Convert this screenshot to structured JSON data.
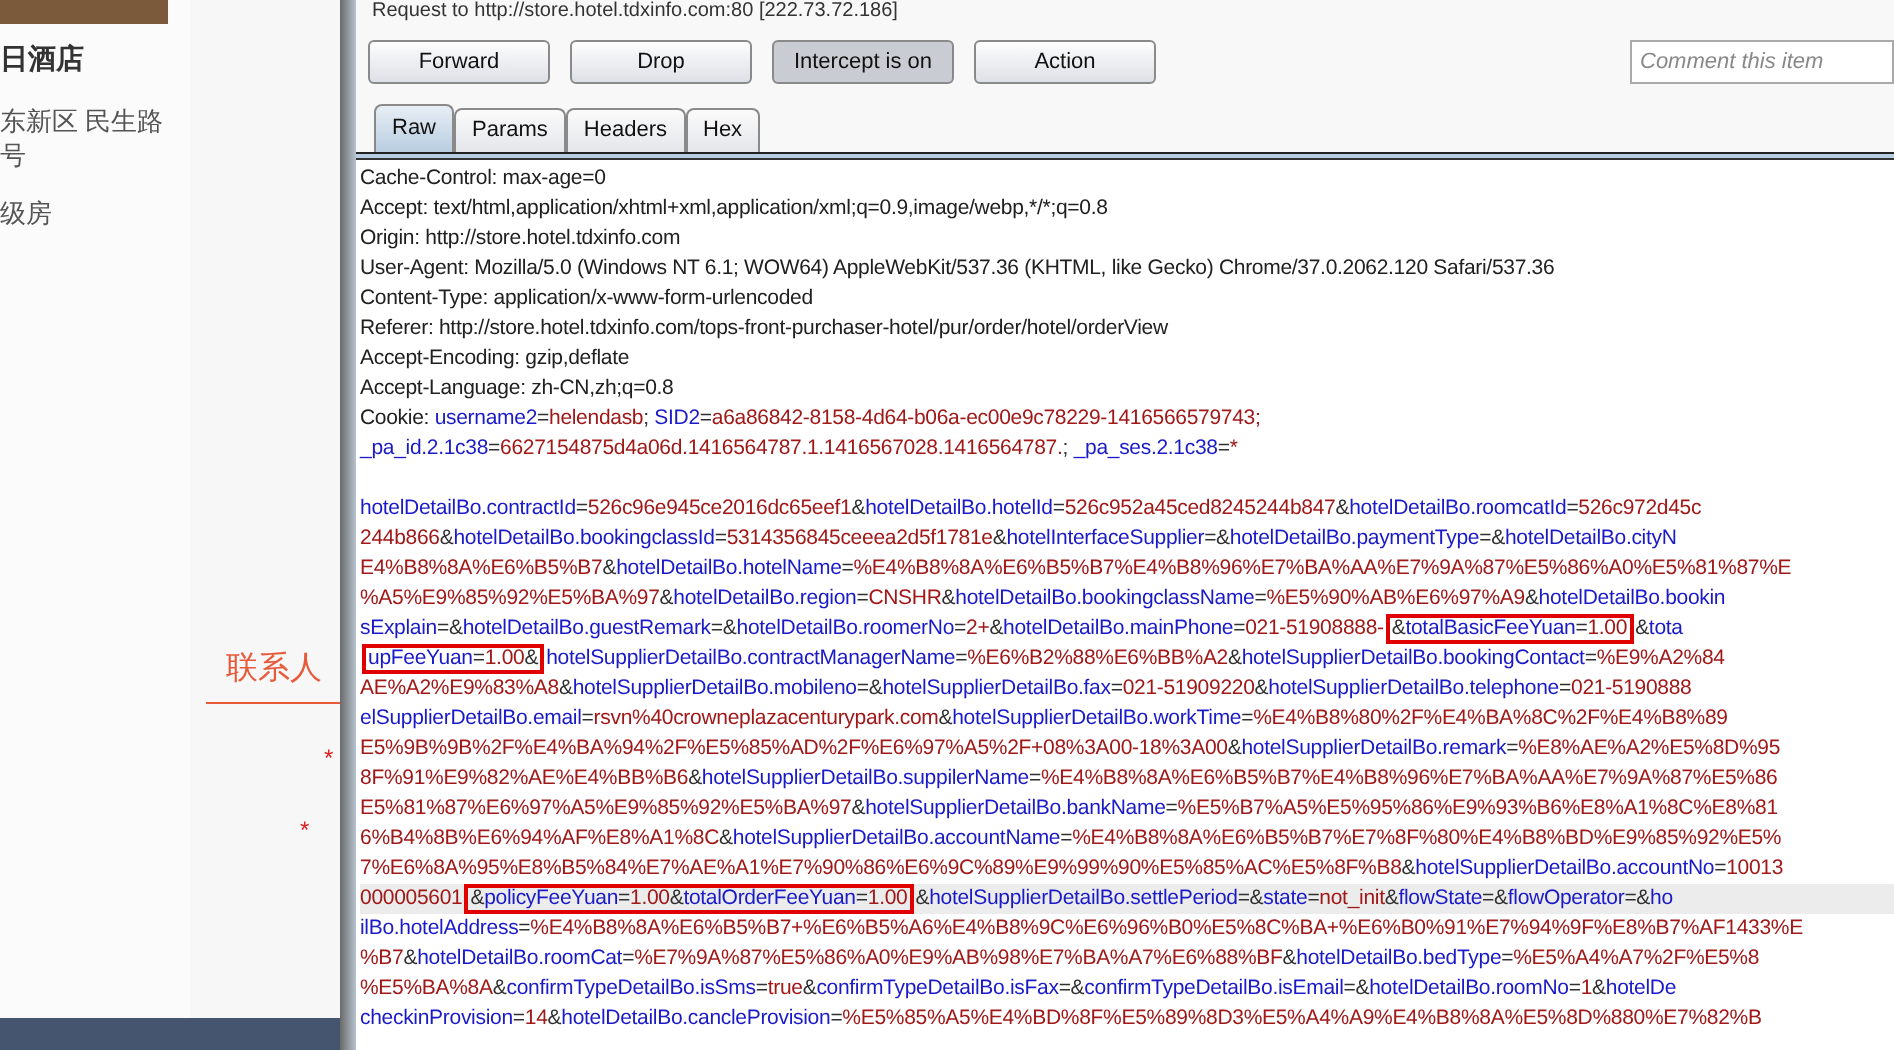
{
  "page": {
    "hotel_name": "日酒店",
    "address_lines": [
      "东新区 民生路",
      "号"
    ],
    "room_type": "级房",
    "section_title": "联系人",
    "required_marks": [
      "*",
      "*"
    ]
  },
  "burp": {
    "request_title": "Request to http://store.hotel.tdxinfo.com:80  [222.73.72.186]",
    "buttons": [
      {
        "label": "Forward",
        "pressed": false
      },
      {
        "label": "Drop",
        "pressed": false
      },
      {
        "label": "Intercept is on",
        "pressed": true
      },
      {
        "label": "Action",
        "pressed": false
      }
    ],
    "comment": {
      "placeholder": "Comment this item"
    },
    "tabs": [
      {
        "label": "Raw",
        "selected": true
      },
      {
        "label": "Params",
        "selected": false
      },
      {
        "label": "Headers",
        "selected": false
      },
      {
        "label": "Hex",
        "selected": false
      }
    ],
    "headers": [
      {
        "segments": [
          {
            "kind": "plain",
            "text": "Cache-Control: max-age=0"
          }
        ]
      },
      {
        "segments": [
          {
            "kind": "plain",
            "text": "Accept: text/html,application/xhtml+xml,application/xml;q=0.9,image/webp,*/*;q=0.8"
          }
        ]
      },
      {
        "segments": [
          {
            "kind": "plain",
            "text": "Origin: http://store.hotel.tdxinfo.com"
          }
        ]
      },
      {
        "segments": [
          {
            "kind": "plain",
            "text": "User-Agent: Mozilla/5.0 (Windows NT 6.1; WOW64) AppleWebKit/537.36 (KHTML, like Gecko) Chrome/37.0.2062.120 Safari/537.36"
          }
        ]
      },
      {
        "segments": [
          {
            "kind": "plain",
            "text": "Content-Type: application/x-www-form-urlencoded"
          }
        ]
      },
      {
        "segments": [
          {
            "kind": "plain",
            "text": "Referer: http://store.hotel.tdxinfo.com/tops-front-purchaser-hotel/pur/order/hotel/orderView"
          }
        ]
      },
      {
        "segments": [
          {
            "kind": "plain",
            "text": "Accept-Encoding: gzip,deflate"
          }
        ]
      },
      {
        "segments": [
          {
            "kind": "plain",
            "text": "Accept-Language: zh-CN,zh;q=0.8"
          }
        ]
      },
      {
        "segments": [
          {
            "kind": "plain",
            "text": "Cookie: "
          },
          {
            "kind": "key",
            "text": "username2"
          },
          {
            "kind": "sep",
            "text": "="
          },
          {
            "kind": "value",
            "text": "helendasb"
          },
          {
            "kind": "sep",
            "text": "; "
          },
          {
            "kind": "key",
            "text": "SID2"
          },
          {
            "kind": "sep",
            "text": "="
          },
          {
            "kind": "value",
            "text": "a6a86842-8158-4d64-b06a-ec00e9c78229-1416566579743;"
          }
        ]
      },
      {
        "segments": [
          {
            "kind": "key",
            "text": "_pa_id.2.1c38"
          },
          {
            "kind": "sep",
            "text": "="
          },
          {
            "kind": "value",
            "text": "6627154875d4a06d.1416564787.1.1416567028.1416564787."
          },
          {
            "kind": "sep",
            "text": "; "
          },
          {
            "kind": "key",
            "text": "_pa_ses.2.1c38"
          },
          {
            "kind": "sep",
            "text": "="
          },
          {
            "kind": "value",
            "text": "*"
          }
        ]
      }
    ],
    "body": [
      {
        "selected": false,
        "runs": [
          {
            "boxed": false,
            "segments": [
              {
                "kind": "key",
                "text": "hotelDetailBo.contractId"
              },
              {
                "kind": "sep",
                "text": "="
              },
              {
                "kind": "value",
                "text": "526c96e945ce2016dc65eef1"
              },
              {
                "kind": "sep",
                "text": "&"
              },
              {
                "kind": "key",
                "text": "hotelDetailBo.hotelId"
              },
              {
                "kind": "sep",
                "text": "="
              },
              {
                "kind": "value",
                "text": "526c952a45ced8245244b847"
              },
              {
                "kind": "sep",
                "text": "&"
              },
              {
                "kind": "key",
                "text": "hotelDetailBo.roomcatId"
              },
              {
                "kind": "sep",
                "text": "="
              },
              {
                "kind": "value",
                "text": "526c972d45c"
              }
            ]
          }
        ]
      },
      {
        "selected": false,
        "runs": [
          {
            "boxed": false,
            "segments": [
              {
                "kind": "value",
                "text": "244b866"
              },
              {
                "kind": "sep",
                "text": "&"
              },
              {
                "kind": "key",
                "text": "hotelDetailBo.bookingclassId"
              },
              {
                "kind": "sep",
                "text": "="
              },
              {
                "kind": "value",
                "text": "5314356845ceeea2d5f1781e"
              },
              {
                "kind": "sep",
                "text": "&"
              },
              {
                "kind": "key",
                "text": "hotelInterfaceSupplier"
              },
              {
                "kind": "sep",
                "text": "=&"
              },
              {
                "kind": "key",
                "text": "hotelDetailBo.paymentType"
              },
              {
                "kind": "sep",
                "text": "=&"
              },
              {
                "kind": "key",
                "text": "hotelDetailBo.cityN"
              }
            ]
          }
        ]
      },
      {
        "selected": false,
        "runs": [
          {
            "boxed": false,
            "segments": [
              {
                "kind": "value",
                "text": "E4%B8%8A%E6%B5%B7"
              },
              {
                "kind": "sep",
                "text": "&"
              },
              {
                "kind": "key",
                "text": "hotelDetailBo.hotelName"
              },
              {
                "kind": "sep",
                "text": "="
              },
              {
                "kind": "value",
                "text": "%E4%B8%8A%E6%B5%B7%E4%B8%96%E7%BA%AA%E7%9A%87%E5%86%A0%E5%81%87%E"
              }
            ]
          }
        ]
      },
      {
        "selected": false,
        "runs": [
          {
            "boxed": false,
            "segments": [
              {
                "kind": "value",
                "text": "%A5%E9%85%92%E5%BA%97"
              },
              {
                "kind": "sep",
                "text": "&"
              },
              {
                "kind": "key",
                "text": "hotelDetailBo.region"
              },
              {
                "kind": "sep",
                "text": "="
              },
              {
                "kind": "value",
                "text": "CNSHR"
              },
              {
                "kind": "sep",
                "text": "&"
              },
              {
                "kind": "key",
                "text": "hotelDetailBo.bookingclassName"
              },
              {
                "kind": "sep",
                "text": "="
              },
              {
                "kind": "value",
                "text": "%E5%90%AB%E6%97%A9"
              },
              {
                "kind": "sep",
                "text": "&"
              },
              {
                "kind": "key",
                "text": "hotelDetailBo.bookin"
              }
            ]
          }
        ]
      },
      {
        "selected": false,
        "runs": [
          {
            "boxed": false,
            "segments": [
              {
                "kind": "key",
                "text": "sExplain"
              },
              {
                "kind": "sep",
                "text": "=&"
              },
              {
                "kind": "key",
                "text": "hotelDetailBo.guestRemark"
              },
              {
                "kind": "sep",
                "text": "=&"
              },
              {
                "kind": "key",
                "text": "hotelDetailBo.roomerNo"
              },
              {
                "kind": "sep",
                "text": "="
              },
              {
                "kind": "value",
                "text": "2+"
              },
              {
                "kind": "sep",
                "text": "&"
              },
              {
                "kind": "key",
                "text": "hotelDetailBo.mainPhone"
              },
              {
                "kind": "sep",
                "text": "="
              },
              {
                "kind": "value",
                "text": "021-51908888-"
              }
            ]
          },
          {
            "boxed": true,
            "segments": [
              {
                "kind": "sep",
                "text": "&"
              },
              {
                "kind": "key",
                "text": "totalBasicFeeYuan"
              },
              {
                "kind": "sep",
                "text": "="
              },
              {
                "kind": "value",
                "text": "1.00"
              }
            ]
          },
          {
            "boxed": false,
            "segments": [
              {
                "kind": "sep",
                "text": "&"
              },
              {
                "kind": "key",
                "text": "tota"
              }
            ]
          }
        ]
      },
      {
        "selected": false,
        "runs": [
          {
            "boxed": true,
            "segments": [
              {
                "kind": "key",
                "text": "upFeeYuan"
              },
              {
                "kind": "sep",
                "text": "="
              },
              {
                "kind": "value",
                "text": "1.00"
              },
              {
                "kind": "sep",
                "text": "&"
              }
            ]
          },
          {
            "boxed": false,
            "segments": [
              {
                "kind": "key",
                "text": "hotelSupplierDetailBo.contractManagerName"
              },
              {
                "kind": "sep",
                "text": "="
              },
              {
                "kind": "value",
                "text": "%E6%B2%88%E6%BB%A2"
              },
              {
                "kind": "sep",
                "text": "&"
              },
              {
                "kind": "key",
                "text": "hotelSupplierDetailBo.bookingContact"
              },
              {
                "kind": "sep",
                "text": "="
              },
              {
                "kind": "value",
                "text": "%E9%A2%84"
              }
            ]
          }
        ]
      },
      {
        "selected": false,
        "runs": [
          {
            "boxed": false,
            "segments": [
              {
                "kind": "value",
                "text": "AE%A2%E9%83%A8"
              },
              {
                "kind": "sep",
                "text": "&"
              },
              {
                "kind": "key",
                "text": "hotelSupplierDetailBo.mobileno"
              },
              {
                "kind": "sep",
                "text": "=&"
              },
              {
                "kind": "key",
                "text": "hotelSupplierDetailBo.fax"
              },
              {
                "kind": "sep",
                "text": "="
              },
              {
                "kind": "value",
                "text": "021-51909220"
              },
              {
                "kind": "sep",
                "text": "&"
              },
              {
                "kind": "key",
                "text": "hotelSupplierDetailBo.telephone"
              },
              {
                "kind": "sep",
                "text": "="
              },
              {
                "kind": "value",
                "text": "021-5190888"
              }
            ]
          }
        ]
      },
      {
        "selected": false,
        "runs": [
          {
            "boxed": false,
            "segments": [
              {
                "kind": "key",
                "text": "elSupplierDetailBo.email"
              },
              {
                "kind": "sep",
                "text": "="
              },
              {
                "kind": "value",
                "text": "rsvn%40crowneplazacenturypark.com"
              },
              {
                "kind": "sep",
                "text": "&"
              },
              {
                "kind": "key",
                "text": "hotelSupplierDetailBo.workTime"
              },
              {
                "kind": "sep",
                "text": "="
              },
              {
                "kind": "value",
                "text": "%E4%B8%80%2F%E4%BA%8C%2F%E4%B8%89"
              }
            ]
          }
        ]
      },
      {
        "selected": false,
        "runs": [
          {
            "boxed": false,
            "segments": [
              {
                "kind": "value",
                "text": "E5%9B%9B%2F%E4%BA%94%2F%E5%85%AD%2F%E6%97%A5%2F+08%3A00-18%3A00"
              },
              {
                "kind": "sep",
                "text": "&"
              },
              {
                "kind": "key",
                "text": "hotelSupplierDetailBo.remark"
              },
              {
                "kind": "sep",
                "text": "="
              },
              {
                "kind": "value",
                "text": "%E8%AE%A2%E5%8D%95"
              }
            ]
          }
        ]
      },
      {
        "selected": false,
        "runs": [
          {
            "boxed": false,
            "segments": [
              {
                "kind": "value",
                "text": "8F%91%E9%82%AE%E4%BB%B6"
              },
              {
                "kind": "sep",
                "text": "&"
              },
              {
                "kind": "key",
                "text": "hotelSupplierDetailBo.suppilerName"
              },
              {
                "kind": "sep",
                "text": "="
              },
              {
                "kind": "value",
                "text": "%E4%B8%8A%E6%B5%B7%E4%B8%96%E7%BA%AA%E7%9A%87%E5%86"
              }
            ]
          }
        ]
      },
      {
        "selected": false,
        "runs": [
          {
            "boxed": false,
            "segments": [
              {
                "kind": "value",
                "text": "E5%81%87%E6%97%A5%E9%85%92%E5%BA%97"
              },
              {
                "kind": "sep",
                "text": "&"
              },
              {
                "kind": "key",
                "text": "hotelSupplierDetailBo.bankName"
              },
              {
                "kind": "sep",
                "text": "="
              },
              {
                "kind": "value",
                "text": "%E5%B7%A5%E5%95%86%E9%93%B6%E8%A1%8C%E8%81"
              }
            ]
          }
        ]
      },
      {
        "selected": false,
        "runs": [
          {
            "boxed": false,
            "segments": [
              {
                "kind": "value",
                "text": "6%B4%8B%E6%94%AF%E8%A1%8C"
              },
              {
                "kind": "sep",
                "text": "&"
              },
              {
                "kind": "key",
                "text": "hotelSupplierDetailBo.accountName"
              },
              {
                "kind": "sep",
                "text": "="
              },
              {
                "kind": "value",
                "text": "%E4%B8%8A%E6%B5%B7%E7%8F%80%E4%B8%BD%E9%85%92%E5%"
              }
            ]
          }
        ]
      },
      {
        "selected": false,
        "runs": [
          {
            "boxed": false,
            "segments": [
              {
                "kind": "value",
                "text": "7%E6%8A%95%E8%B5%84%E7%AE%A1%E7%90%86%E6%9C%89%E9%99%90%E5%85%AC%E5%8F%B8"
              },
              {
                "kind": "sep",
                "text": "&"
              },
              {
                "kind": "key",
                "text": "hotelSupplierDetailBo.accountNo"
              },
              {
                "kind": "sep",
                "text": "="
              },
              {
                "kind": "value",
                "text": "10013"
              }
            ]
          }
        ]
      },
      {
        "selected": true,
        "runs": [
          {
            "boxed": false,
            "segments": [
              {
                "kind": "value",
                "text": "000005601"
              }
            ]
          },
          {
            "boxed": true,
            "segments": [
              {
                "kind": "sep",
                "text": "&"
              },
              {
                "kind": "key",
                "text": "policyFeeYuan"
              },
              {
                "kind": "sep",
                "text": "="
              },
              {
                "kind": "value",
                "text": "1.00"
              },
              {
                "kind": "sep",
                "text": "&"
              },
              {
                "kind": "key",
                "text": "totalOrderFeeYuan"
              },
              {
                "kind": "sep",
                "text": "="
              },
              {
                "kind": "value",
                "text": "1.00"
              }
            ]
          },
          {
            "boxed": false,
            "segments": [
              {
                "kind": "sep",
                "text": "&"
              },
              {
                "kind": "key",
                "text": "hotelSupplierDetailBo.settlePeriod"
              },
              {
                "kind": "sep",
                "text": "=&"
              },
              {
                "kind": "key",
                "text": "state"
              },
              {
                "kind": "sep",
                "text": "="
              },
              {
                "kind": "value",
                "text": "not_init"
              },
              {
                "kind": "sep",
                "text": "&"
              },
              {
                "kind": "key",
                "text": "flowState"
              },
              {
                "kind": "sep",
                "text": "=&"
              },
              {
                "kind": "key",
                "text": "flowOperator"
              },
              {
                "kind": "sep",
                "text": "=&"
              },
              {
                "kind": "key",
                "text": "ho"
              }
            ]
          }
        ]
      },
      {
        "selected": false,
        "runs": [
          {
            "boxed": false,
            "segments": [
              {
                "kind": "key",
                "text": "ilBo.hotelAddress"
              },
              {
                "kind": "sep",
                "text": "="
              },
              {
                "kind": "value",
                "text": "%E4%B8%8A%E6%B5%B7+%E6%B5%A6%E4%B8%9C%E6%96%B0%E5%8C%BA+%E6%B0%91%E7%94%9F%E8%B7%AF1433%E"
              }
            ]
          }
        ]
      },
      {
        "selected": false,
        "runs": [
          {
            "boxed": false,
            "segments": [
              {
                "kind": "value",
                "text": "%B7"
              },
              {
                "kind": "sep",
                "text": "&"
              },
              {
                "kind": "key",
                "text": "hotelDetailBo.roomCat"
              },
              {
                "kind": "sep",
                "text": "="
              },
              {
                "kind": "value",
                "text": "%E7%9A%87%E5%86%A0%E9%AB%98%E7%BA%A7%E6%88%BF"
              },
              {
                "kind": "sep",
                "text": "&"
              },
              {
                "kind": "key",
                "text": "hotelDetailBo.bedType"
              },
              {
                "kind": "sep",
                "text": "="
              },
              {
                "kind": "value",
                "text": "%E5%A4%A7%2F%E5%8"
              }
            ]
          }
        ]
      },
      {
        "selected": false,
        "runs": [
          {
            "boxed": false,
            "segments": [
              {
                "kind": "value",
                "text": "%E5%BA%8A"
              },
              {
                "kind": "sep",
                "text": "&"
              },
              {
                "kind": "key",
                "text": "confirmTypeDetailBo.isSms"
              },
              {
                "kind": "sep",
                "text": "="
              },
              {
                "kind": "value",
                "text": "true"
              },
              {
                "kind": "sep",
                "text": "&"
              },
              {
                "kind": "key",
                "text": "confirmTypeDetailBo.isFax"
              },
              {
                "kind": "sep",
                "text": "=&"
              },
              {
                "kind": "key",
                "text": "confirmTypeDetailBo.isEmail"
              },
              {
                "kind": "sep",
                "text": "=&"
              },
              {
                "kind": "key",
                "text": "hotelDetailBo.roomNo"
              },
              {
                "kind": "sep",
                "text": "="
              },
              {
                "kind": "value",
                "text": "1"
              },
              {
                "kind": "sep",
                "text": "&"
              },
              {
                "kind": "key",
                "text": "hotelDe"
              }
            ]
          }
        ]
      },
      {
        "selected": false,
        "runs": [
          {
            "boxed": false,
            "segments": [
              {
                "kind": "key",
                "text": "checkinProvision"
              },
              {
                "kind": "sep",
                "text": "="
              },
              {
                "kind": "value",
                "text": "14"
              },
              {
                "kind": "sep",
                "text": "&"
              },
              {
                "kind": "key",
                "text": "hotelDetailBo.cancleProvision"
              },
              {
                "kind": "sep",
                "text": "="
              },
              {
                "kind": "value",
                "text": "%E5%85%A5%E4%BD%8F%E5%89%8D3%E5%A4%A9%E4%B8%8A%E5%8D%880%E7%82%B"
              }
            ]
          }
        ]
      }
    ]
  }
}
